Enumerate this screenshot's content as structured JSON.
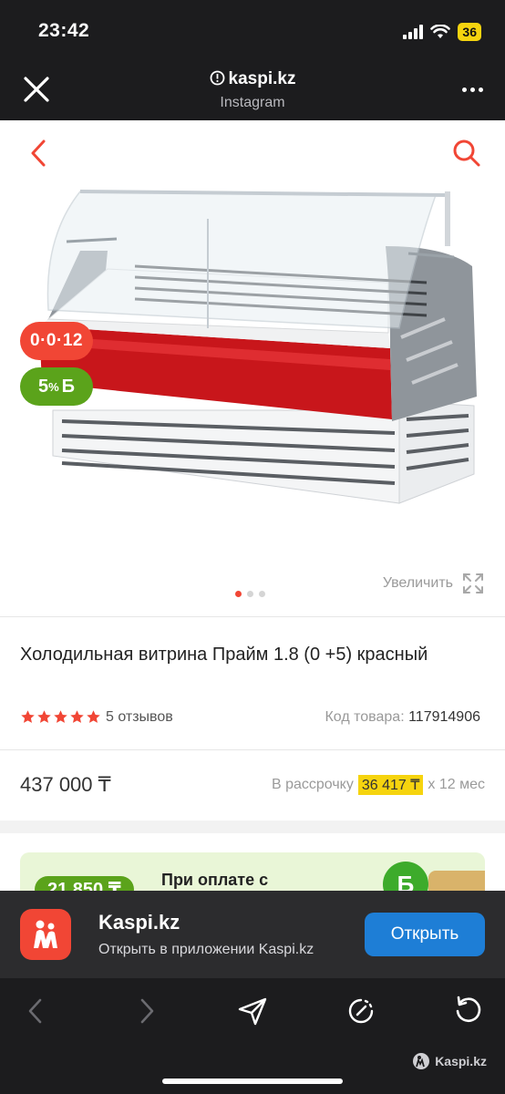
{
  "status_bar": {
    "time": "23:42",
    "battery": "36"
  },
  "browser": {
    "domain": "kaspi.kz",
    "subtitle": "Instagram"
  },
  "gallery": {
    "zoom_label": "Увеличить"
  },
  "badges": {
    "installment": "0·0·12",
    "bonus_value": "5",
    "bonus_unit": "%",
    "bonus_symbol": "Б"
  },
  "product": {
    "title": "Холодильная витрина Прайм 1.8 (0 +5) красный",
    "rating": 5,
    "reviews": "5 отзывов",
    "sku_label": "Код товара:",
    "sku_value": "117914906",
    "price": "437 000 ₸",
    "installment_prefix": "В рассрочку",
    "installment_amount": "36 417 ₸",
    "installment_suffix": "х 12 мес"
  },
  "promo": {
    "amount": "21 850 ₸",
    "text": "При оплате с",
    "coin": "Б"
  },
  "app_banner": {
    "name": "Kaspi.kz",
    "description": "Открыть в приложении Kaspi.kz",
    "button": "Открыть"
  },
  "watermark": "Kaspi.kz",
  "colors": {
    "brand_red": "#f14635",
    "bonus_green": "#5ba31b",
    "highlight_yellow": "#f6d40f",
    "open_blue": "#1e7ed6"
  }
}
